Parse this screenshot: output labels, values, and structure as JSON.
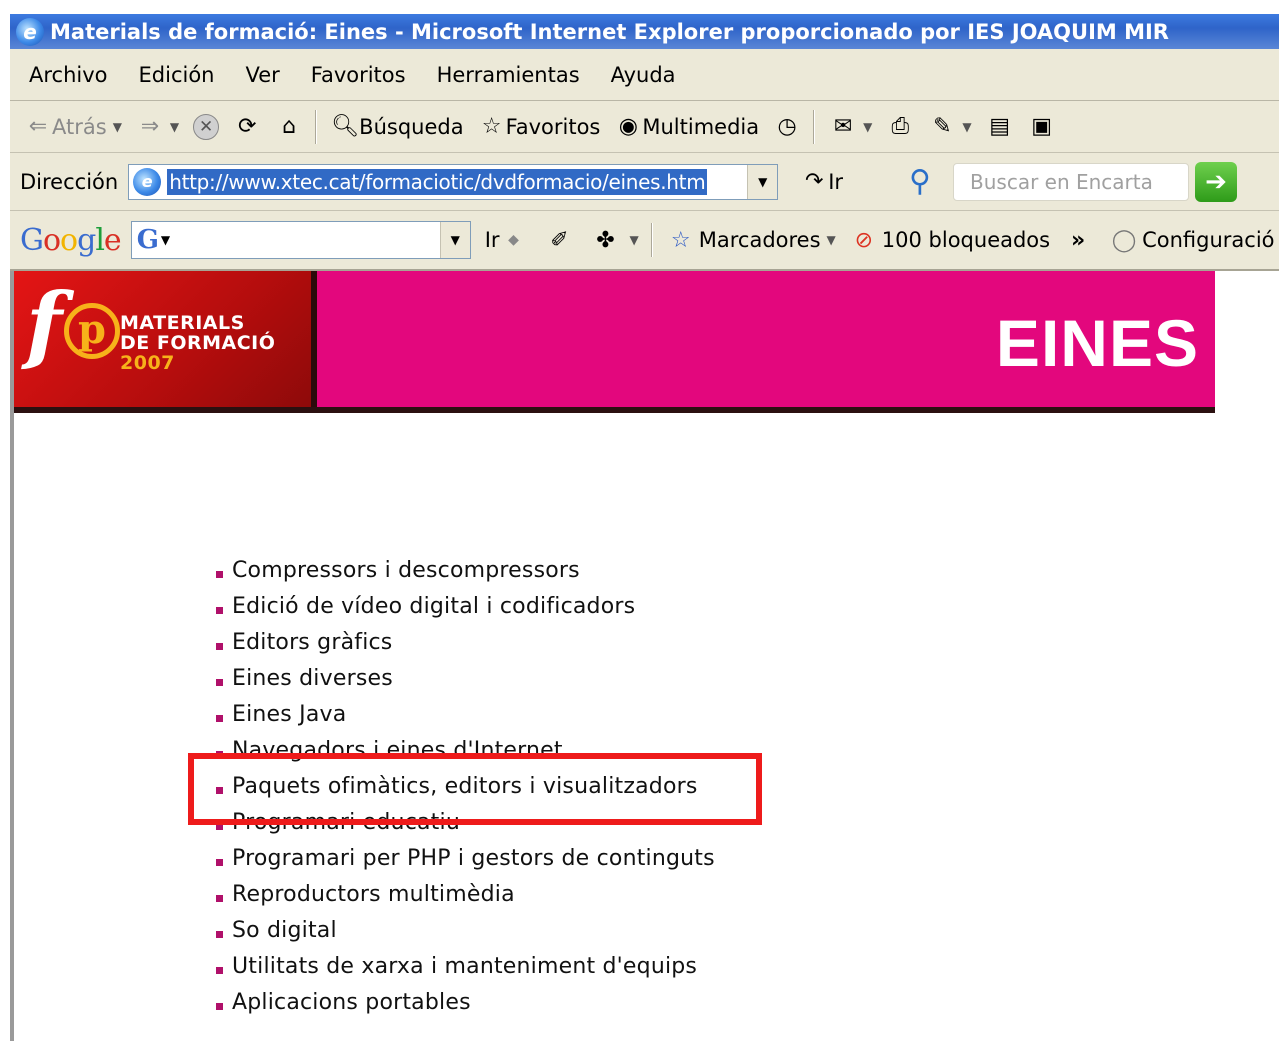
{
  "window": {
    "title": "Materials de formació: Eines - Microsoft Internet Explorer proporcionado por IES JOAQUIM MIR",
    "app_icon": "ie-icon"
  },
  "menu": [
    "Archivo",
    "Edición",
    "Ver",
    "Favoritos",
    "Herramientas",
    "Ayuda"
  ],
  "toolbar": {
    "back_label": "Atrás",
    "search_label": "Búsqueda",
    "favorites_label": "Favoritos",
    "media_label": "Multimedia"
  },
  "address": {
    "label": "Dirección",
    "url": "http://www.xtec.cat/formaciotic/dvdformacio/eines.htm",
    "go_label": "Ir",
    "encarta_placeholder": "Buscar en Encarta"
  },
  "google_bar": {
    "logo": "Google",
    "search_badge": "G",
    "go_label": "Ir",
    "bookmarks_label": "Marcadores",
    "blocked_label": "100 bloqueados",
    "settings_label": "Configuració"
  },
  "banner": {
    "logo_letters": "f",
    "logo_p": "p",
    "brand_line1": "MATERIALS",
    "brand_line2": "DE FORMACIÓ",
    "brand_year": "2007",
    "section_title": "EINES",
    "colors": {
      "left": "#d41010",
      "right": "#e3077d",
      "accent": "#f7b21a"
    }
  },
  "links": [
    "Compressors i descompressors",
    "Edició de vídeo digital i codificadors",
    "Editors gràfics",
    "Eines diverses",
    "Eines Java",
    "Navegadors i eines d'Internet",
    "Paquets ofimàtics, editors i visualitzadors",
    "Programari educatiu",
    "Programari per PHP i gestors de continguts",
    "Reproductors multimèdia",
    "So digital",
    "Utilitats de xarxa i manteniment d'equips",
    "Aplicacions portables"
  ],
  "highlight": {
    "target": "Paquets ofimàtics, editors i visualitzadors",
    "color": "#ee1b1b"
  }
}
